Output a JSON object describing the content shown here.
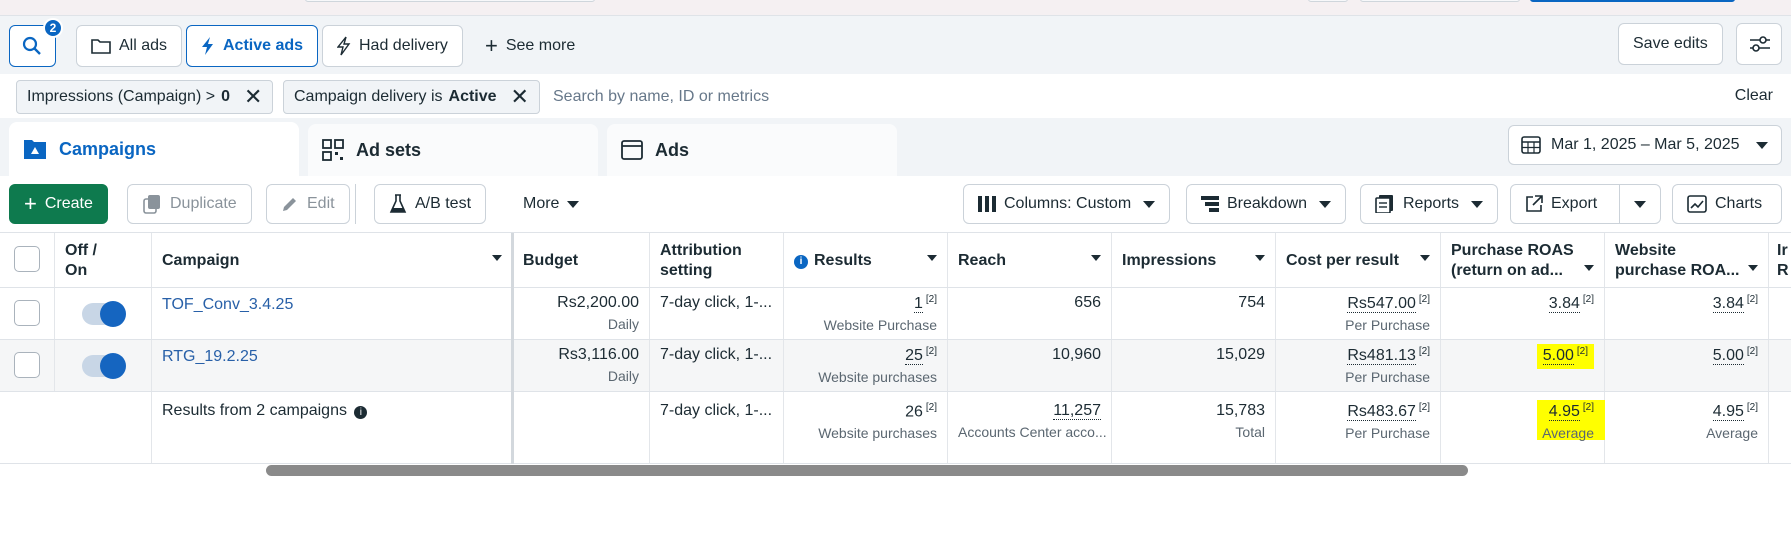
{
  "toolbar": {
    "search_badge": "2",
    "all_ads": "All ads",
    "active_ads": "Active ads",
    "had_delivery": "Had delivery",
    "see_more": "See more",
    "save_edits": "Save edits"
  },
  "filters": {
    "chip1_text": "Impressions (Campaign) >",
    "chip1_value": "0",
    "chip2_text": "Campaign delivery is",
    "chip2_value": "Active",
    "search_placeholder": "Search by name, ID or metrics",
    "clear": "Clear"
  },
  "tabs": {
    "campaigns": "Campaigns",
    "ad_sets": "Ad sets",
    "ads": "Ads"
  },
  "date_range": "Mar 1, 2025 – Mar 5, 2025",
  "actions": {
    "create": "Create",
    "duplicate": "Duplicate",
    "edit": "Edit",
    "ab_test": "A/B test",
    "more": "More",
    "columns": "Columns: Custom",
    "breakdown": "Breakdown",
    "reports": "Reports",
    "export": "Export",
    "charts": "Charts"
  },
  "table": {
    "headers": {
      "off_on_1": "Off /",
      "off_on_2": "On",
      "campaign": "Campaign",
      "budget": "Budget",
      "attribution_1": "Attribution",
      "attribution_2": "setting",
      "results": "Results",
      "reach": "Reach",
      "impressions": "Impressions",
      "cost_per_result": "Cost per result",
      "roas_1": "Purchase ROAS",
      "roas_2": "(return on ad...",
      "web_roas_1": "Website",
      "web_roas_2": "purchase ROA...",
      "cut_1": "Ir",
      "cut_2": "R"
    },
    "footnote": "[2]",
    "rows": [
      {
        "campaign": "TOF_Conv_3.4.25",
        "budget": "Rs2,200.00",
        "budget_sub": "Daily",
        "attribution": "7-day click, 1-...",
        "results": "1",
        "results_sub": "Website Purchase",
        "reach": "656",
        "impressions": "754",
        "cost": "Rs547.00",
        "cost_sub": "Per Purchase",
        "roas": "3.84",
        "web_roas": "3.84"
      },
      {
        "campaign": "RTG_19.2.25",
        "budget": "Rs3,116.00",
        "budget_sub": "Daily",
        "attribution": "7-day click, 1-...",
        "results": "25",
        "results_sub": "Website purchases",
        "reach": "10,960",
        "impressions": "15,029",
        "cost": "Rs481.13",
        "cost_sub": "Per Purchase",
        "roas": "5.00",
        "web_roas": "5.00"
      }
    ],
    "total": {
      "label": "Results from 2 campaigns",
      "attribution": "7-day click, 1-...",
      "results": "26",
      "results_sub": "Website purchases",
      "reach": "11,257",
      "reach_sub": "Accounts Center acco...",
      "impressions": "15,783",
      "impressions_sub": "Total",
      "cost": "Rs483.67",
      "cost_sub": "Per Purchase",
      "roas": "4.95",
      "roas_sub": "Average",
      "web_roas": "4.95",
      "web_roas_sub": "Average"
    }
  },
  "colors": {
    "accent": "#0a66c2",
    "create_green": "#0e7a4e",
    "highlight": "#ffff00",
    "link": "#2860a8"
  }
}
